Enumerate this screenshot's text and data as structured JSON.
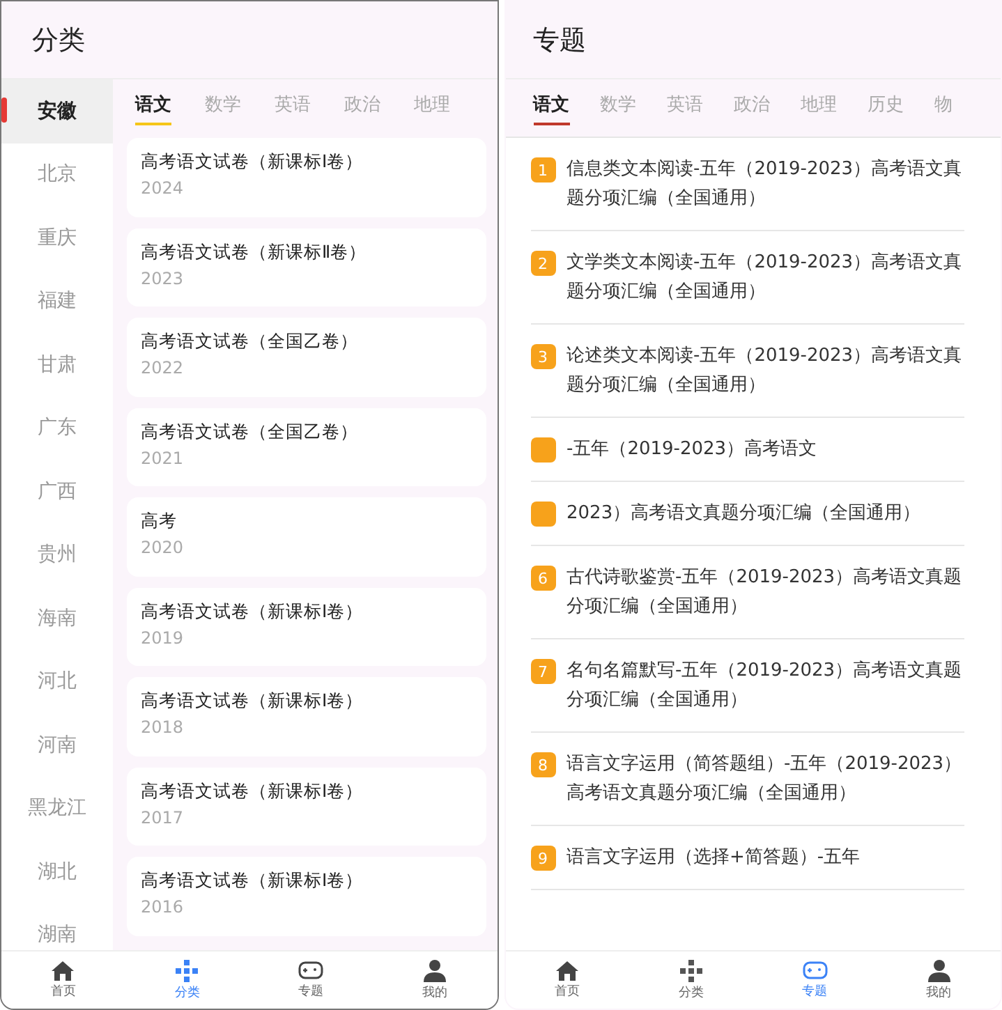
{
  "left": {
    "title": "分类",
    "provinces": [
      {
        "label": "安徽",
        "selected": true
      },
      {
        "label": "北京",
        "selected": false
      },
      {
        "label": "重庆",
        "selected": false
      },
      {
        "label": "福建",
        "selected": false
      },
      {
        "label": "甘肃",
        "selected": false
      },
      {
        "label": "广东",
        "selected": false
      },
      {
        "label": "广西",
        "selected": false
      },
      {
        "label": "贵州",
        "selected": false
      },
      {
        "label": "海南",
        "selected": false
      },
      {
        "label": "河北",
        "selected": false
      },
      {
        "label": "河南",
        "selected": false
      },
      {
        "label": "黑龙江",
        "selected": false
      },
      {
        "label": "湖北",
        "selected": false
      },
      {
        "label": "湖南",
        "selected": false
      }
    ],
    "tabs": [
      {
        "label": "语文",
        "selected": true
      },
      {
        "label": "数学",
        "selected": false
      },
      {
        "label": "英语",
        "selected": false
      },
      {
        "label": "政治",
        "selected": false
      },
      {
        "label": "地理",
        "selected": false
      }
    ],
    "papers": [
      {
        "title": "高考语文试卷（新课标Ⅰ卷）",
        "year": "2024"
      },
      {
        "title": "高考语文试卷（新课标Ⅱ卷）",
        "year": "2023"
      },
      {
        "title": "高考语文试卷（全国乙卷）",
        "year": "2022"
      },
      {
        "title": "高考语文试卷（全国乙卷）",
        "year": "2021"
      },
      {
        "title": "高考",
        "year": "2020"
      },
      {
        "title": "高考语文试卷（新课标Ⅰ卷）",
        "year": "2019"
      },
      {
        "title": "高考语文试卷（新课标Ⅰ卷）",
        "year": "2018"
      },
      {
        "title": "高考语文试卷（新课标Ⅰ卷）",
        "year": "2017"
      },
      {
        "title": "高考语文试卷（新课标Ⅰ卷）",
        "year": "2016"
      }
    ],
    "nav": [
      {
        "label": "首页",
        "kind": "home",
        "selected": false
      },
      {
        "label": "分类",
        "kind": "grid",
        "selected": true
      },
      {
        "label": "专题",
        "kind": "gamepad",
        "selected": false
      },
      {
        "label": "我的",
        "kind": "user",
        "selected": false
      }
    ]
  },
  "right": {
    "title": "专题",
    "tabs": [
      {
        "label": "语文",
        "selected": true
      },
      {
        "label": "数学",
        "selected": false
      },
      {
        "label": "英语",
        "selected": false
      },
      {
        "label": "政治",
        "selected": false
      },
      {
        "label": "地理",
        "selected": false
      },
      {
        "label": "历史",
        "selected": false
      },
      {
        "label": "物",
        "selected": false
      }
    ],
    "topics": [
      {
        "num": "1",
        "title": "信息类文本阅读-五年（2019-2023）高考语文真题分项汇编（全国通用）"
      },
      {
        "num": "2",
        "title": "文学类文本阅读-五年（2019-2023）高考语文真题分项汇编（全国通用）"
      },
      {
        "num": "3",
        "title": "论述类文本阅读-五年（2019-2023）高考语文真题分项汇编（全国通用）"
      },
      {
        "title": "-五年（2019-2023）高考语文"
      },
      {
        "title": "2023）高考语文真题分项汇编（全国通用）"
      },
      {
        "num": "6",
        "title": "古代诗歌鉴赏-五年（2019-2023）高考语文真题分项汇编（全国通用）"
      },
      {
        "num": "7",
        "title": "名句名篇默写-五年（2019-2023）高考语文真题分项汇编（全国通用）"
      },
      {
        "num": "8",
        "title": "语言文字运用（简答题组）-五年（2019-2023）高考语文真题分项汇编（全国通用）"
      },
      {
        "num": "9",
        "title": "语言文字运用（选择+简答题）-五年"
      }
    ],
    "nav": [
      {
        "label": "首页",
        "kind": "home",
        "selected": false
      },
      {
        "label": "分类",
        "kind": "grid",
        "selected": false
      },
      {
        "label": "专题",
        "kind": "gamepad",
        "selected": true
      },
      {
        "label": "我的",
        "kind": "user",
        "selected": false
      }
    ]
  }
}
